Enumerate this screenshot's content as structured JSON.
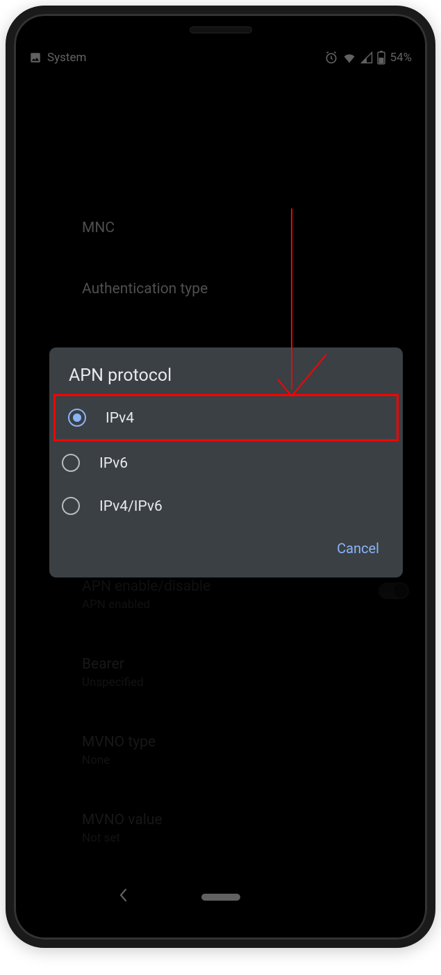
{
  "status_bar": {
    "notification_label": "System",
    "battery_text": "54%"
  },
  "settings": {
    "mnc": {
      "title": "MNC"
    },
    "auth_type": {
      "title": "Authentication type"
    },
    "apn_enable": {
      "title": "APN enable/disable",
      "sub": "APN enabled"
    },
    "bearer": {
      "title": "Bearer",
      "sub": "Unspecified"
    },
    "mvno_type": {
      "title": "MVNO type",
      "sub": "None"
    },
    "mvno_value": {
      "title": "MVNO value",
      "sub": "Not set"
    }
  },
  "dialog": {
    "title": "APN protocol",
    "options": {
      "ipv4": "IPv4",
      "ipv6": "IPv6",
      "ipv4v6": "IPv4/IPv6"
    },
    "selected": "ipv4",
    "cancel_label": "Cancel"
  }
}
